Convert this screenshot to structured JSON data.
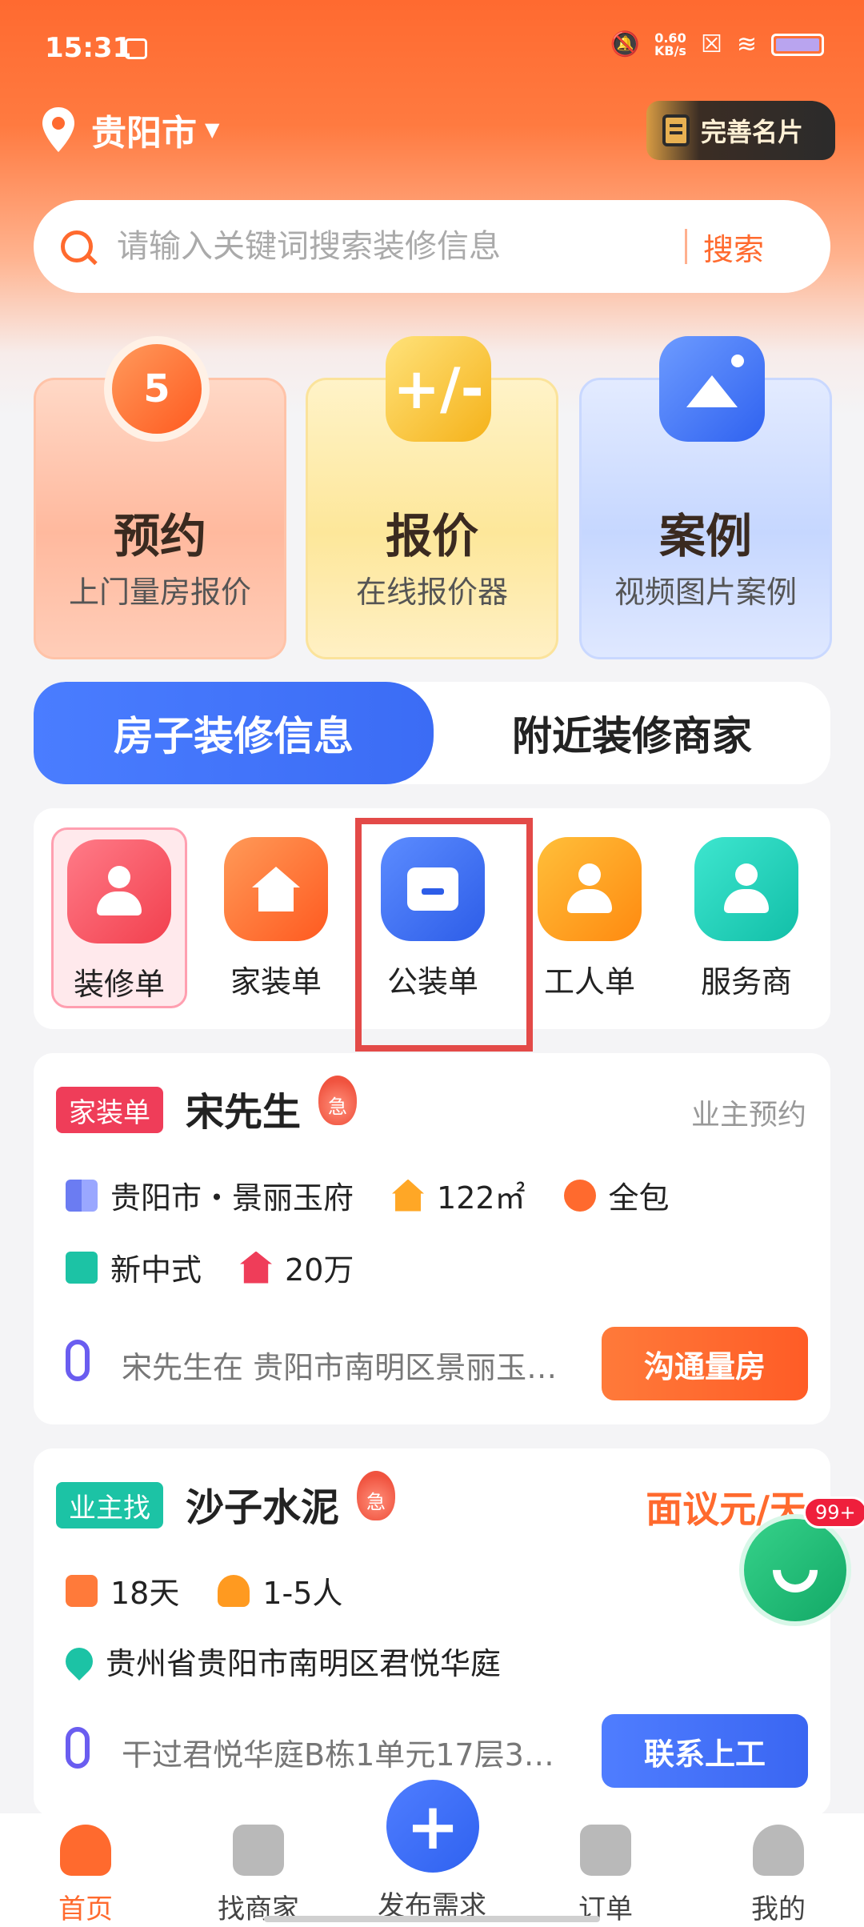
{
  "status_bar": {
    "time": "15:31",
    "net_speed_value": "0.60",
    "net_speed_unit": "KB/s",
    "icons": [
      "sim-icon",
      "mute-icon",
      "close-box-icon",
      "wifi-icon",
      "battery-icon"
    ]
  },
  "header": {
    "location": "贵阳市",
    "profile_button": "完善名片"
  },
  "search": {
    "placeholder": "请输入关键词搜索装修信息",
    "button": "搜索"
  },
  "features": [
    {
      "icon_text": "5",
      "title": "预约",
      "subtitle": "上门量房报价"
    },
    {
      "icon_text": "+/-",
      "title": "报价",
      "subtitle": "在线报价器"
    },
    {
      "icon_text": "",
      "title": "案例",
      "subtitle": "视频图片案例"
    }
  ],
  "tabs": {
    "active": "房子装修信息",
    "inactive": "附近装修商家"
  },
  "categories": [
    {
      "label": "装修单",
      "selected": true
    },
    {
      "label": "家装单",
      "selected": false
    },
    {
      "label": "公装单",
      "selected": false
    },
    {
      "label": "工人单",
      "selected": false
    },
    {
      "label": "服务商",
      "selected": false
    }
  ],
  "listings": [
    {
      "tag": "家装单",
      "title": "宋先生",
      "urgent": "急",
      "status": "业主预约",
      "location": "贵阳市・景丽玉府",
      "area": "122㎡",
      "package": "全包",
      "style": "新中式",
      "budget": "20万",
      "description": "宋先生在 贵阳市南明区景丽玉…",
      "action": "沟通量房"
    },
    {
      "tag": "业主找",
      "title": "沙子水泥",
      "urgent": "急",
      "price": "面议元/天",
      "duration": "18天",
      "people": "1-5人",
      "address": "贵州省贵阳市南明区君悦华庭",
      "description": "干过君悦华庭B栋1单元17层3…",
      "action": "联系上工"
    }
  ],
  "call_fab": {
    "badge": "99+"
  },
  "bottom_nav": {
    "items": [
      {
        "label": "首页",
        "active": true
      },
      {
        "label": "找商家",
        "active": false
      },
      {
        "label": "发布需求",
        "active": false
      },
      {
        "label": "订单",
        "active": false
      },
      {
        "label": "我的",
        "active": false
      }
    ],
    "publish_symbol": "+"
  },
  "colors": {
    "brand_orange": "#ff6a2e",
    "brand_blue": "#3b6cf5",
    "teal": "#1cc3a5",
    "red_tag": "#ef3d59"
  }
}
